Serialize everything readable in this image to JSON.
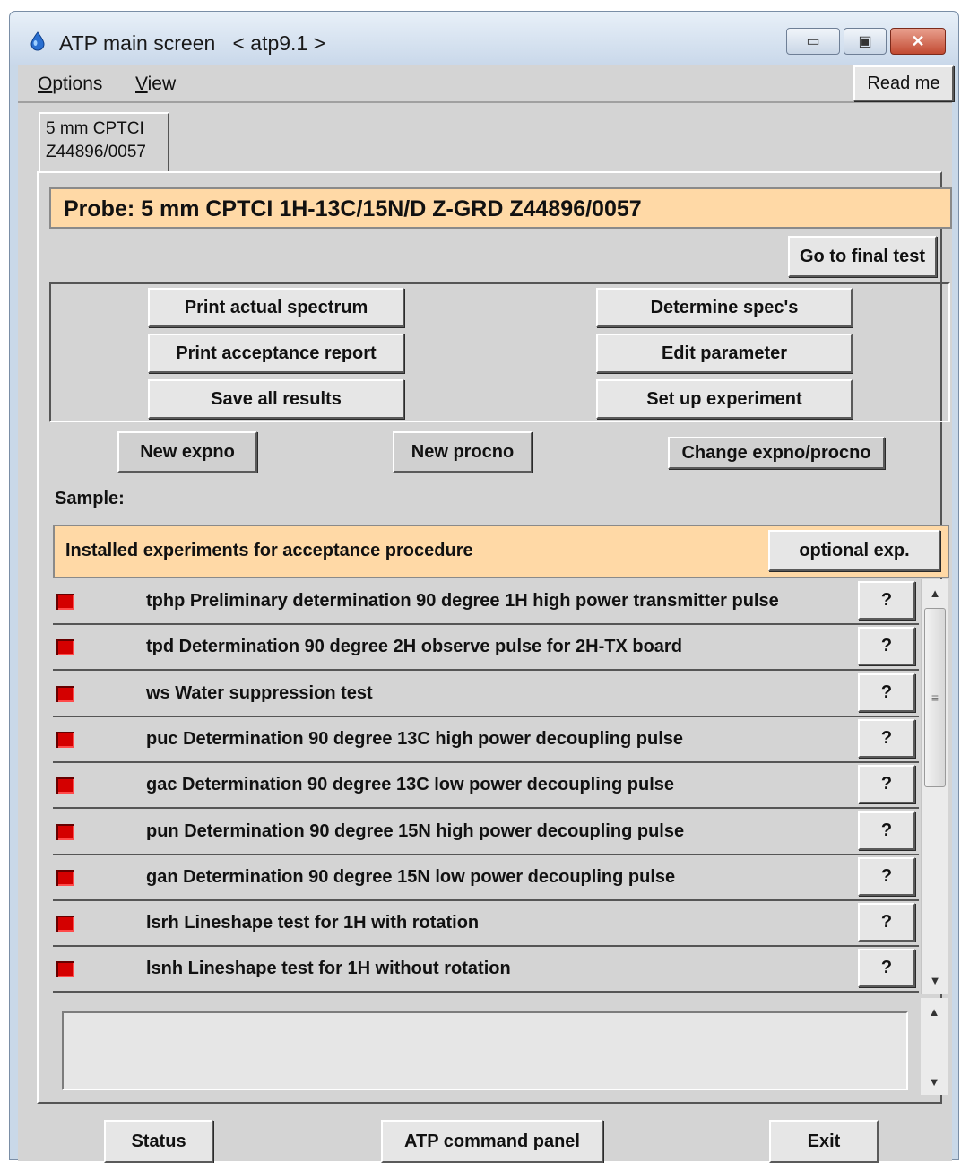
{
  "window": {
    "title": "ATP main screen",
    "subtitle": "< atp9.1 >",
    "minimize_glyph": "▭",
    "maximize_glyph": "▣",
    "close_glyph": "✕"
  },
  "menu": {
    "options": "Options",
    "view": "View",
    "read_me": "Read me"
  },
  "tab": {
    "line1": "5 mm CPTCI",
    "line2": "Z44896/0057"
  },
  "probe": {
    "label": "Probe: 5 mm CPTCI 1H-13C/15N/D Z-GRD Z44896/0057"
  },
  "actions": {
    "go_final": "Go to final test",
    "print_actual": "Print actual spectrum",
    "print_report": "Print acceptance report",
    "save_results": "Save all results",
    "determine_specs": "Determine spec's",
    "edit_parameter": "Edit parameter",
    "setup_experiment": "Set up experiment",
    "new_expno": "New expno",
    "new_procno": "New procno",
    "change_expno": "Change expno/procno"
  },
  "sample": {
    "label": "Sample:"
  },
  "experiments": {
    "title": "Installed experiments for acceptance procedure",
    "optional_button": "optional exp.",
    "help_label": "?",
    "items": [
      {
        "label": "tphp Preliminary determination 90 degree 1H high power transmitter pulse",
        "status_color": "#d40000"
      },
      {
        "label": "tpd Determination 90 degree 2H observe pulse for 2H-TX board",
        "status_color": "#d40000"
      },
      {
        "label": "ws Water suppression test",
        "status_color": "#d40000"
      },
      {
        "label": "puc Determination 90 degree 13C high power decoupling pulse",
        "status_color": "#d40000"
      },
      {
        "label": "gac Determination 90 degree 13C low power decoupling pulse",
        "status_color": "#d40000"
      },
      {
        "label": "pun Determination 90 degree 15N high power decoupling pulse",
        "status_color": "#d40000"
      },
      {
        "label": "gan Determination 90 degree 15N low power decoupling pulse",
        "status_color": "#d40000"
      },
      {
        "label": "lsrh Lineshape test for 1H with rotation",
        "status_color": "#d40000"
      },
      {
        "label": "lsnh Lineshape test for 1H without rotation",
        "status_color": "#d40000"
      }
    ]
  },
  "log": {
    "text": ""
  },
  "footer": {
    "status": "Status",
    "command_panel": "ATP command panel",
    "exit": "Exit"
  },
  "colors": {
    "highlight_bar": "#ffd9a6",
    "status_failed": "#d40000"
  }
}
